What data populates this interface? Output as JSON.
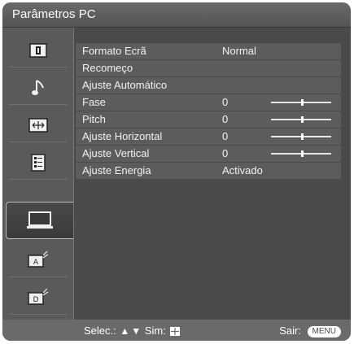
{
  "header": {
    "title": "Parâmetros PC"
  },
  "sidebar": {
    "items": [
      {
        "icon": "picture-icon"
      },
      {
        "icon": "music-note-icon"
      },
      {
        "icon": "screen-icon"
      },
      {
        "icon": "setup-list-icon"
      },
      {
        "icon": "pc-monitor-icon",
        "active": true
      },
      {
        "icon": "input-a-icon"
      },
      {
        "icon": "input-d-icon"
      }
    ]
  },
  "settings": [
    {
      "label": "Formato Ecrã",
      "value": "Normal"
    },
    {
      "label": "Recomeço",
      "value": ""
    },
    {
      "label": "Ajuste Automático",
      "value": ""
    },
    {
      "label": "Fase",
      "value": "0",
      "slider": 0.5
    },
    {
      "label": "Pitch",
      "value": "0",
      "slider": 0.5
    },
    {
      "label": "Ajuste Horizontal",
      "value": "0",
      "slider": 0.5
    },
    {
      "label": "Ajuste Vertical",
      "value": "0",
      "slider": 0.5
    },
    {
      "label": "Ajuste Energia",
      "value": "Activado"
    }
  ],
  "footer": {
    "select_label": "Selec.:",
    "confirm_label": "Sim:",
    "exit_label": "Sair:",
    "menu_button": "MENU"
  }
}
